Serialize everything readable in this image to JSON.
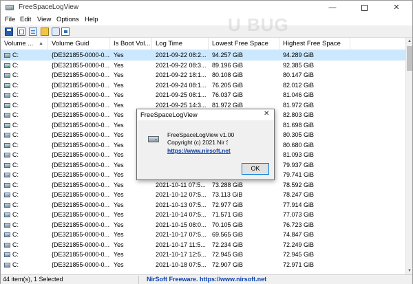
{
  "window": {
    "title": "FreeSpaceLogView"
  },
  "menu": [
    {
      "label": "File"
    },
    {
      "label": "Edit"
    },
    {
      "label": "View"
    },
    {
      "label": "Options"
    },
    {
      "label": "Help"
    }
  ],
  "toolbar": {
    "icons": [
      "save-icon",
      "copy-icon",
      "html-report-icon",
      "properties-icon",
      "find-icon",
      "exit-icon"
    ]
  },
  "columns": [
    "Volume ...",
    "Volume Guid",
    "Is Boot Vol...",
    "Log Time",
    "Lowest Free Space",
    "Highest Free Space"
  ],
  "rows": [
    {
      "vol": "C:",
      "guid": "{DE321855-0000-0...",
      "boot": "Yes",
      "time": "2021-09-22 08:2...",
      "low": "94.257 GiB",
      "high": "94.289 GiB",
      "selected": true
    },
    {
      "vol": "C:",
      "guid": "{DE321855-0000-0...",
      "boot": "Yes",
      "time": "2021-09-22 08:3...",
      "low": "89.196 GiB",
      "high": "92.385 GiB"
    },
    {
      "vol": "C:",
      "guid": "{DE321855-0000-0...",
      "boot": "Yes",
      "time": "2021-09-22 18:1...",
      "low": "80.108 GiB",
      "high": "80.147 GiB"
    },
    {
      "vol": "C:",
      "guid": "{DE321855-0000-0...",
      "boot": "Yes",
      "time": "2021-09-24 08:1...",
      "low": "76.205 GiB",
      "high": "82.012 GiB"
    },
    {
      "vol": "C:",
      "guid": "{DE321855-0000-0...",
      "boot": "Yes",
      "time": "2021-09-25 08:1...",
      "low": "76.037 GiB",
      "high": "81.046 GiB"
    },
    {
      "vol": "C:",
      "guid": "{DE321855-0000-0...",
      "boot": "Yes",
      "time": "2021-09-25 14:3...",
      "low": "81.972 GiB",
      "high": "81.972 GiB"
    },
    {
      "vol": "C:",
      "guid": "{DE321855-0000-0...",
      "boot": "Yes",
      "time": "",
      "low": "",
      "high": "82.803 GiB"
    },
    {
      "vol": "C:",
      "guid": "{DE321855-0000-0...",
      "boot": "Yes",
      "time": "",
      "low": "",
      "high": "81.698 GiB"
    },
    {
      "vol": "C:",
      "guid": "{DE321855-0000-0...",
      "boot": "Yes",
      "time": "",
      "low": "",
      "high": "80.305 GiB"
    },
    {
      "vol": "C:",
      "guid": "{DE321855-0000-0...",
      "boot": "Yes",
      "time": "",
      "low": "",
      "high": "80.680 GiB"
    },
    {
      "vol": "C:",
      "guid": "{DE321855-0000-0...",
      "boot": "Yes",
      "time": "",
      "low": "",
      "high": "81.093 GiB"
    },
    {
      "vol": "C:",
      "guid": "{DE321855-0000-0...",
      "boot": "Yes",
      "time": "",
      "low": "",
      "high": "79.937 GiB"
    },
    {
      "vol": "C:",
      "guid": "{DE321855-0000-0...",
      "boot": "Yes",
      "time": "",
      "low": "",
      "high": "79.741 GiB"
    },
    {
      "vol": "C:",
      "guid": "{DE321855-0000-0...",
      "boot": "Yes",
      "time": "2021-10-11 07:5...",
      "low": "73.288 GiB",
      "high": "78.592 GiB"
    },
    {
      "vol": "C:",
      "guid": "{DE321855-0000-0...",
      "boot": "Yes",
      "time": "2021-10-12 07:5...",
      "low": "73.113 GiB",
      "high": "78.247 GiB"
    },
    {
      "vol": "C:",
      "guid": "{DE321855-0000-0...",
      "boot": "Yes",
      "time": "2021-10-13 07:5...",
      "low": "72.977 GiB",
      "high": "77.914 GiB"
    },
    {
      "vol": "C:",
      "guid": "{DE321855-0000-0...",
      "boot": "Yes",
      "time": "2021-10-14 07:5...",
      "low": "71.571 GiB",
      "high": "77.073 GiB"
    },
    {
      "vol": "C:",
      "guid": "{DE321855-0000-0...",
      "boot": "Yes",
      "time": "2021-10-15 08:0...",
      "low": "70.105 GiB",
      "high": "76.723 GiB"
    },
    {
      "vol": "C:",
      "guid": "{DE321855-0000-0...",
      "boot": "Yes",
      "time": "2021-10-17 07:5...",
      "low": "69.565 GiB",
      "high": "74.847 GiB"
    },
    {
      "vol": "C:",
      "guid": "{DE321855-0000-0...",
      "boot": "Yes",
      "time": "2021-10-17 11:5...",
      "low": "72.234 GiB",
      "high": "72.249 GiB"
    },
    {
      "vol": "C:",
      "guid": "{DE321855-0000-0...",
      "boot": "Yes",
      "time": "2021-10-17 12:5...",
      "low": "72.945 GiB",
      "high": "72.945 GiB"
    },
    {
      "vol": "C:",
      "guid": "{DE321855-0000-0...",
      "boot": "Yes",
      "time": "2021-10-18 07:5...",
      "low": "72.907 GiB",
      "high": "72.971 GiB"
    }
  ],
  "status": {
    "count": "44 item(s), 1 Selected",
    "link": "NirSoft Freeware. https://www.nirsoft.net"
  },
  "watermark": "U BUG",
  "about": {
    "title": "FreeSpaceLogView",
    "name": "FreeSpaceLogView v1.00",
    "copyright": "Copyright (c) 2021 Nir Sofer",
    "link": "https://www.nirsoft.net",
    "ok": "OK",
    "close": "✕"
  }
}
